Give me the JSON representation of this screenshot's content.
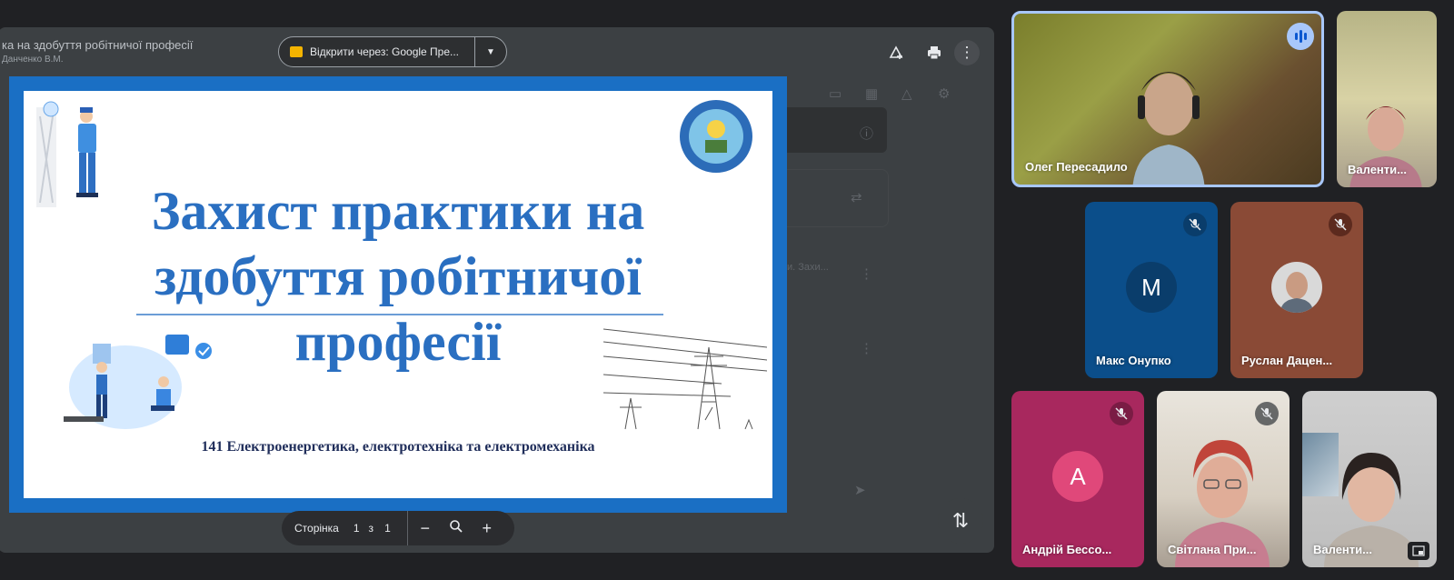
{
  "viewer": {
    "doc_title": "ка на здобуття робітничої професії",
    "doc_author": "Данченко В.М.",
    "open_with_label": "Відкрити через: Google Пре...",
    "toolbar_icons": [
      "add-to-drive-icon",
      "print-icon",
      "more-vert-icon"
    ]
  },
  "slide": {
    "title_line1": "Захист практики на",
    "title_line2": "здобуття робітничої",
    "title_line3": "професії",
    "footer": "141 Електроенергетика, електротехніка та електромеханіка",
    "accent_color": "#2a6fc1",
    "frame_color": "#1a6fc4"
  },
  "page_controls": {
    "label": "Сторінка",
    "current": "1",
    "of": "з",
    "total": "1"
  },
  "participants": [
    {
      "name": "Олег Пересадило",
      "speaking": true
    },
    {
      "name": "Валенти..."
    },
    {
      "name": "Макс Онупко",
      "initial": "M",
      "muted": true,
      "color": "#0b4e8a"
    },
    {
      "name": "Руслан Дацен...",
      "muted": true,
      "color": "#8a4a36"
    },
    {
      "name": "Андрій Бессо...",
      "initial": "A",
      "muted": true,
      "color": "#a8285e"
    },
    {
      "name": "Світлана При...",
      "muted": true
    },
    {
      "name": "Валенти..."
    }
  ]
}
